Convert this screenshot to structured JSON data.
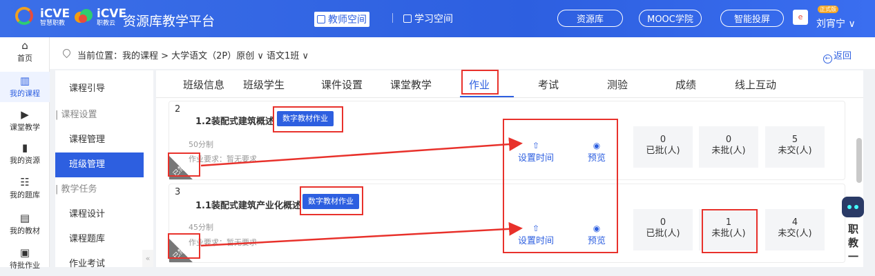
{
  "brand": {
    "icve1": "iCVE",
    "icve1_sub": "智慧职教",
    "icve2": "iCVE",
    "icve2_sub": "职教云",
    "platform": "资源库教学平台"
  },
  "topnav": {
    "teacher_space": "教师空间",
    "study_space": "学习空间",
    "resource_lib": "资源库",
    "mooc": "MOOC学院",
    "smart_cast": "智能投屏",
    "badge": "正式版",
    "user": "刘宵宁 ∨"
  },
  "leftnav": [
    {
      "label": "首页",
      "icon": "home-icon"
    },
    {
      "label": "我的课程",
      "icon": "book-icon"
    },
    {
      "label": "课堂教学",
      "icon": "play-icon"
    },
    {
      "label": "我的资源",
      "icon": "bars-icon"
    },
    {
      "label": "我的题库",
      "icon": "questions-icon"
    },
    {
      "label": "我的教材",
      "icon": "textbook-icon"
    },
    {
      "label": "待批作业",
      "icon": "grading-icon"
    }
  ],
  "breadcrumb": {
    "text": "当前位置：我的课程 > 大学语文（2P）原创 ∨  语文1班 ∨",
    "back": "返回"
  },
  "subnav": [
    {
      "label": "课程引导"
    },
    {
      "label": "| 课程设置"
    },
    {
      "label": "课程管理"
    },
    {
      "label": "班级管理"
    },
    {
      "label": "| 教学任务"
    },
    {
      "label": "课程设计"
    },
    {
      "label": "课程题库"
    },
    {
      "label": "作业考试"
    }
  ],
  "tabs": [
    "班级信息",
    "班级学生",
    "课件设置",
    "课堂教学",
    "作业",
    "考试",
    "测验",
    "成绩",
    "线上互动"
  ],
  "cards": [
    {
      "num": "2",
      "title": "1.2装配式建筑概述",
      "tag": "数字教材作业",
      "score": "50分制",
      "req": "作业要求：暂无要求",
      "status": "已禁用",
      "set_time": "设置时间",
      "preview": "预览",
      "stats": [
        {
          "n": "0",
          "l": "已批(人)"
        },
        {
          "n": "0",
          "l": "未批(人)"
        },
        {
          "n": "5",
          "l": "未交(人)"
        }
      ]
    },
    {
      "num": "3",
      "title": "1.1装配式建筑产业化概述",
      "tag": "数字教材作业",
      "score": "45分制",
      "req": "作业要求：暂无要求",
      "status": "已禁用",
      "set_time": "设置时间",
      "preview": "预览",
      "stats": [
        {
          "n": "0",
          "l": "已批(人)"
        },
        {
          "n": "1",
          "l": "未批(人)"
        },
        {
          "n": "4",
          "l": "未交(人)"
        }
      ]
    }
  ],
  "assistant": {
    "text": "职教一"
  },
  "colors": {
    "primary": "#2d5fe0",
    "highlight": "#e8312b"
  }
}
